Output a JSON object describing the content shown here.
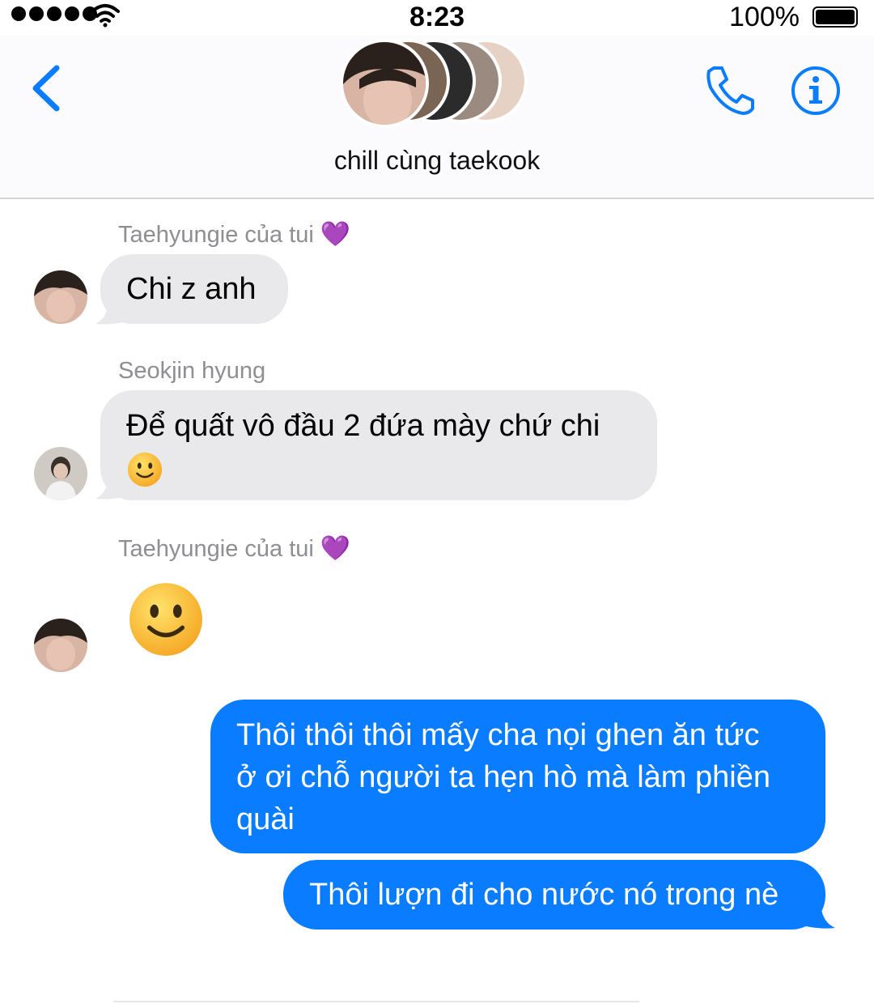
{
  "status_bar": {
    "time": "8:23",
    "battery_percent": "100%",
    "signal_bars": 5
  },
  "header": {
    "group_name": "chill cùng taekook",
    "back_icon": "chevron-left-icon",
    "call_icon": "phone-icon",
    "info_icon": "info-icon",
    "accent_color": "#0a7cff"
  },
  "messages": [
    {
      "sender": "Taehyungie của tui",
      "sender_emoji": "💜",
      "text": "Chi z anh",
      "direction": "incoming"
    },
    {
      "sender": "Seokjin hyung",
      "text": "Để quất vô đầu 2 đứa mày chứ chi",
      "emoji": "🙂",
      "direction": "incoming"
    },
    {
      "sender": "Taehyungie của tui",
      "sender_emoji": "💜",
      "emoji": "🙂",
      "direction": "incoming"
    },
    {
      "lines": [
        "Thôi thôi thôi mấy cha nọi ghen ăn tức",
        "ở ơi chỗ người ta hẹn hò mà làm phiền",
        "quài"
      ],
      "direction": "outgoing"
    },
    {
      "text": "Thôi lượn đi cho nước nó trong nè",
      "direction": "outgoing"
    }
  ],
  "colors": {
    "incoming_bubble": "#e9e9eb",
    "outgoing_bubble": "#0a7cff",
    "sender_name": "#8e8e93"
  }
}
